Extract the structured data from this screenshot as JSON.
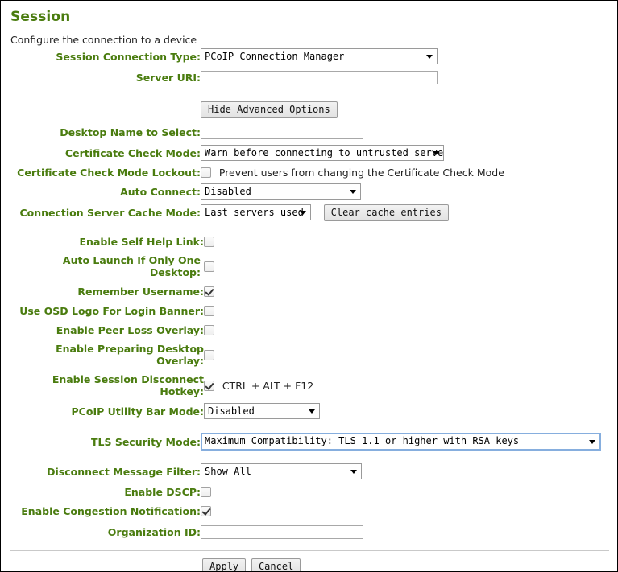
{
  "page": {
    "title": "Session",
    "description": "Configure the connection to a device"
  },
  "advanced_toggle": {
    "label": "Hide Advanced Options"
  },
  "fields": {
    "session_connection_type": {
      "label": "Session Connection Type:",
      "value": "PCoIP Connection Manager",
      "type": "select"
    },
    "server_uri": {
      "label": "Server URI:",
      "value": "",
      "placeholder": "",
      "type": "text"
    },
    "desktop_name_to_select": {
      "label": "Desktop Name to Select:",
      "value": "",
      "placeholder": "",
      "type": "text"
    },
    "certificate_check_mode": {
      "label": "Certificate Check Mode:",
      "value": "Warn before connecting to untrusted servers",
      "type": "select"
    },
    "certificate_check_mode_lockout": {
      "label": "Certificate Check Mode Lockout:",
      "checked": false,
      "caption": "Prevent users from changing the Certificate Check Mode",
      "type": "checkbox"
    },
    "auto_connect": {
      "label": "Auto Connect:",
      "value": "Disabled",
      "type": "select"
    },
    "connection_server_cache_mode": {
      "label": "Connection Server Cache Mode:",
      "value": "Last servers used",
      "type": "select",
      "button_label": "Clear cache entries"
    },
    "enable_self_help_link": {
      "label": "Enable Self Help Link:",
      "checked": false,
      "type": "checkbox"
    },
    "auto_launch_if_only_one_desktop": {
      "label": "Auto Launch If Only One Desktop:",
      "checked": false,
      "type": "checkbox"
    },
    "remember_username": {
      "label": "Remember Username:",
      "checked": true,
      "type": "checkbox"
    },
    "use_osd_logo_for_login_banner": {
      "label": "Use OSD Logo For Login Banner:",
      "checked": false,
      "type": "checkbox"
    },
    "enable_peer_loss_overlay": {
      "label": "Enable Peer Loss Overlay:",
      "checked": false,
      "type": "checkbox"
    },
    "enable_preparing_desktop_overlay": {
      "label": "Enable Preparing Desktop Overlay:",
      "checked": false,
      "type": "checkbox"
    },
    "enable_session_disconnect_hotkey": {
      "label": "Enable Session Disconnect Hotkey:",
      "checked": true,
      "caption": "CTRL + ALT + F12",
      "type": "checkbox"
    },
    "pcoip_utility_bar_mode": {
      "label": "PCoIP Utility Bar Mode:",
      "value": "Disabled",
      "type": "select"
    },
    "tls_security_mode": {
      "label": "TLS Security Mode:",
      "value": "Maximum Compatibility: TLS 1.1 or higher with RSA keys",
      "type": "select",
      "focused": true
    },
    "disconnect_message_filter": {
      "label": "Disconnect Message Filter:",
      "value": "Show All",
      "type": "select"
    },
    "enable_dscp": {
      "label": "Enable DSCP:",
      "checked": false,
      "type": "checkbox"
    },
    "enable_congestion_notification": {
      "label": "Enable Congestion Notification:",
      "checked": true,
      "type": "checkbox"
    },
    "organization_id": {
      "label": "Organization ID:",
      "value": "",
      "placeholder": "",
      "type": "text"
    }
  },
  "footer": {
    "apply_label": "Apply",
    "cancel_label": "Cancel"
  },
  "colors": {
    "label_green": "#4a7c0f",
    "title_green": "#4a7c0f",
    "focus_blue": "#86aede",
    "border_gray": "#a8a8a8"
  }
}
